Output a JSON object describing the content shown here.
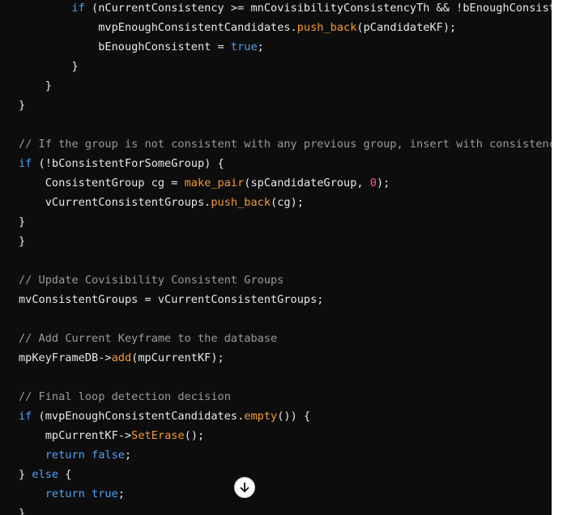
{
  "colors": {
    "background": "#0d0d0d",
    "keyword": "#4ea1f3",
    "function": "#f39a37",
    "number": "#ff5a8a",
    "comment": "#9a9a9a",
    "plain": "#e8e8e8"
  },
  "scroll_button": {
    "icon": "arrow-down-icon"
  },
  "code_lines": [
    {
      "indent": "        ",
      "tokens": [
        {
          "t": "kw",
          "v": "if"
        },
        {
          "t": "plain",
          "v": " (nCurrentConsistency >= mnCovisibilityConsistencyTh && !bEnoughConsistent) {"
        }
      ]
    },
    {
      "indent": "            ",
      "tokens": [
        {
          "t": "plain",
          "v": "mvpEnoughConsistentCandidates."
        },
        {
          "t": "fn",
          "v": "push_back"
        },
        {
          "t": "plain",
          "v": "(pCandidateKF);"
        }
      ]
    },
    {
      "indent": "            ",
      "tokens": [
        {
          "t": "plain",
          "v": "bEnoughConsistent = "
        },
        {
          "t": "kw",
          "v": "true"
        },
        {
          "t": "plain",
          "v": ";"
        }
      ]
    },
    {
      "indent": "        ",
      "tokens": [
        {
          "t": "plain",
          "v": "}"
        }
      ]
    },
    {
      "indent": "    ",
      "tokens": [
        {
          "t": "plain",
          "v": "}"
        }
      ]
    },
    {
      "indent": "",
      "tokens": [
        {
          "t": "plain",
          "v": "}"
        }
      ]
    },
    {
      "indent": "",
      "tokens": []
    },
    {
      "indent": "",
      "tokens": [
        {
          "t": "cm",
          "v": "// If the group is not consistent with any previous group, insert with consistency counter set to zero"
        }
      ]
    },
    {
      "indent": "",
      "tokens": [
        {
          "t": "kw",
          "v": "if"
        },
        {
          "t": "plain",
          "v": " (!bConsistentForSomeGroup) {"
        }
      ]
    },
    {
      "indent": "    ",
      "tokens": [
        {
          "t": "plain",
          "v": "ConsistentGroup cg = "
        },
        {
          "t": "fn",
          "v": "make_pair"
        },
        {
          "t": "plain",
          "v": "(spCandidateGroup, "
        },
        {
          "t": "num",
          "v": "0"
        },
        {
          "t": "plain",
          "v": ");"
        }
      ]
    },
    {
      "indent": "    ",
      "tokens": [
        {
          "t": "plain",
          "v": "vCurrentConsistentGroups."
        },
        {
          "t": "fn",
          "v": "push_back"
        },
        {
          "t": "plain",
          "v": "(cg);"
        }
      ]
    },
    {
      "indent": "",
      "tokens": [
        {
          "t": "plain",
          "v": "}"
        }
      ]
    },
    {
      "indent": "",
      "tokens": [
        {
          "t": "plain",
          "v": "}"
        }
      ]
    },
    {
      "indent": "",
      "tokens": []
    },
    {
      "indent": "",
      "tokens": [
        {
          "t": "cm",
          "v": "// Update Covisibility Consistent Groups"
        }
      ]
    },
    {
      "indent": "",
      "tokens": [
        {
          "t": "plain",
          "v": "mvConsistentGroups = vCurrentConsistentGroups;"
        }
      ]
    },
    {
      "indent": "",
      "tokens": []
    },
    {
      "indent": "",
      "tokens": [
        {
          "t": "cm",
          "v": "// Add Current Keyframe to the database"
        }
      ]
    },
    {
      "indent": "",
      "tokens": [
        {
          "t": "plain",
          "v": "mpKeyFrameDB->"
        },
        {
          "t": "fn",
          "v": "add"
        },
        {
          "t": "plain",
          "v": "(mpCurrentKF);"
        }
      ]
    },
    {
      "indent": "",
      "tokens": []
    },
    {
      "indent": "",
      "tokens": [
        {
          "t": "cm",
          "v": "// Final loop detection decision"
        }
      ]
    },
    {
      "indent": "",
      "tokens": [
        {
          "t": "kw",
          "v": "if"
        },
        {
          "t": "plain",
          "v": " (mvpEnoughConsistentCandidates."
        },
        {
          "t": "fn",
          "v": "empty"
        },
        {
          "t": "plain",
          "v": "()) {"
        }
      ]
    },
    {
      "indent": "    ",
      "tokens": [
        {
          "t": "plain",
          "v": "mpCurrentKF->"
        },
        {
          "t": "fn",
          "v": "SetErase"
        },
        {
          "t": "plain",
          "v": "();"
        }
      ]
    },
    {
      "indent": "    ",
      "tokens": [
        {
          "t": "kw",
          "v": "return"
        },
        {
          "t": "plain",
          "v": " "
        },
        {
          "t": "kw",
          "v": "false"
        },
        {
          "t": "plain",
          "v": ";"
        }
      ]
    },
    {
      "indent": "",
      "tokens": [
        {
          "t": "plain",
          "v": "} "
        },
        {
          "t": "kw",
          "v": "else"
        },
        {
          "t": "plain",
          "v": " {"
        }
      ]
    },
    {
      "indent": "    ",
      "tokens": [
        {
          "t": "kw",
          "v": "return"
        },
        {
          "t": "plain",
          "v": " "
        },
        {
          "t": "kw",
          "v": "true"
        },
        {
          "t": "plain",
          "v": ";"
        }
      ]
    },
    {
      "indent": "",
      "tokens": [
        {
          "t": "plain",
          "v": "}"
        }
      ]
    }
  ]
}
